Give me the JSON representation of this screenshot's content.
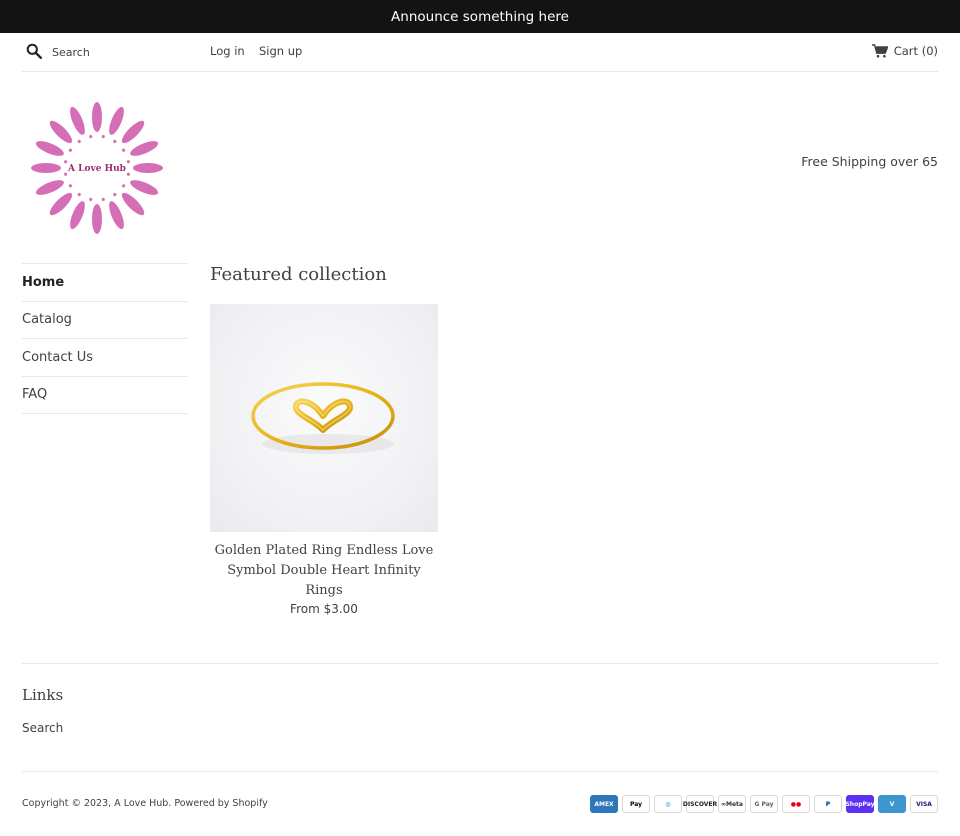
{
  "announcement": "Announce something here",
  "header": {
    "search_placeholder": "Search",
    "login": "Log in",
    "signup": "Sign up",
    "cart": "Cart (0)"
  },
  "logo": {
    "text": "A Love Hub",
    "color": "#d46fb7"
  },
  "shipping_note": "Free Shipping over 65",
  "nav": {
    "items": [
      {
        "label": "Home",
        "active": true
      },
      {
        "label": "Catalog"
      },
      {
        "label": "Contact Us"
      },
      {
        "label": "FAQ"
      }
    ]
  },
  "main": {
    "section_title": "Featured collection",
    "products": [
      {
        "title": "Golden Plated Ring Endless Love Symbol Double Heart Infinity Rings",
        "price": "From $3.00"
      }
    ]
  },
  "footer": {
    "links_title": "Links",
    "links": [
      "Search"
    ],
    "copyright": "Copyright © 2023, A Love Hub. Powered by Shopify",
    "payment_icons": [
      {
        "name": "amex-icon",
        "label": "AMEX",
        "bg": "#2e77bb",
        "fg": "#ffffff"
      },
      {
        "name": "apple-pay-icon",
        "label": "Pay",
        "bg": "#ffffff",
        "fg": "#000000"
      },
      {
        "name": "diners-club-icon",
        "label": "◎",
        "bg": "#ffffff",
        "fg": "#0079be"
      },
      {
        "name": "discover-icon",
        "label": "DISCOVER",
        "bg": "#ffffff",
        "fg": "#222222"
      },
      {
        "name": "meta-pay-icon",
        "label": "∞Meta",
        "bg": "#ffffff",
        "fg": "#333333"
      },
      {
        "name": "google-pay-icon",
        "label": "G Pay",
        "bg": "#ffffff",
        "fg": "#5f6368"
      },
      {
        "name": "mastercard-icon",
        "label": "●●",
        "bg": "#ffffff",
        "fg": "#eb001b"
      },
      {
        "name": "paypal-icon",
        "label": "P",
        "bg": "#ffffff",
        "fg": "#003087"
      },
      {
        "name": "shop-pay-icon",
        "label": "ShopPay",
        "bg": "#5a31f4",
        "fg": "#ffffff"
      },
      {
        "name": "venmo-icon",
        "label": "V",
        "bg": "#3d95ce",
        "fg": "#ffffff"
      },
      {
        "name": "visa-icon",
        "label": "VISA",
        "bg": "#ffffff",
        "fg": "#1a1f71"
      }
    ]
  }
}
